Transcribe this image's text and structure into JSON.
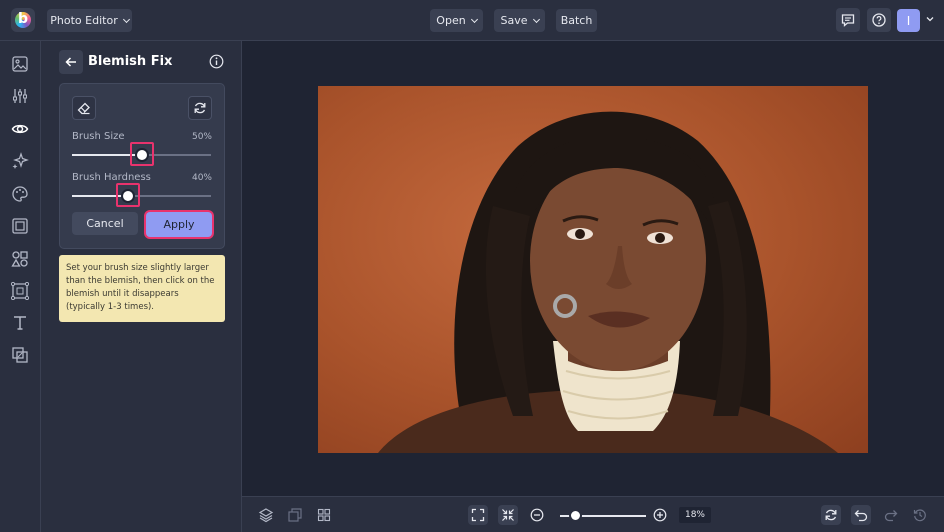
{
  "topbar": {
    "logo_letter": "b",
    "app_menu_label": "Photo Editor",
    "open_label": "Open",
    "save_label": "Save",
    "batch_label": "Batch",
    "avatar_letter": "I",
    "icons": [
      "comment-icon",
      "help-icon"
    ]
  },
  "left_toolbar": {
    "icons": [
      "image-icon",
      "adjust-sliders-icon",
      "eye-icon",
      "sparkle-icon",
      "palette-icon",
      "frame-icon",
      "shapes-icon",
      "texture-icon",
      "text-icon",
      "overlay-icon"
    ],
    "active_icon": "eye-icon"
  },
  "panel": {
    "title": "Blemish Fix",
    "brush_size_label": "Brush Size",
    "brush_size_value": "50%",
    "brush_size_level": 0.5,
    "brush_hardness_label": "Brush Hardness",
    "brush_hardness_value": "40%",
    "brush_hardness_level": 0.4,
    "cancel_label": "Cancel",
    "apply_label": "Apply",
    "tip_text": "Set your brush size slightly larger than the blemish, then click on the blemish until it disappears (typically 1-3 times)."
  },
  "bottombar": {
    "zoom_value": "18%",
    "zoom_level": 0.18
  },
  "colors": {
    "accent": "#8f9bf2",
    "highlight": "#e8336d",
    "tip_background": "#f3e7b1"
  }
}
